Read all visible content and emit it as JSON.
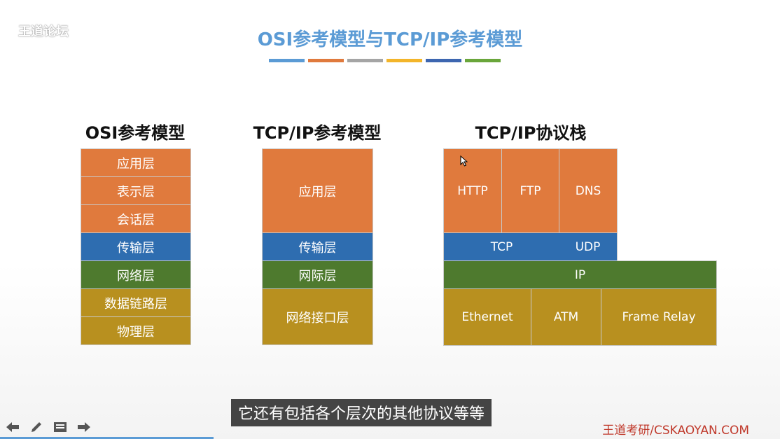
{
  "watermark": "王道论坛",
  "slide_title": "OSI参考模型与TCP/IP参考模型",
  "title_bar_colors": [
    "#5b9bd5",
    "#e07a3d",
    "#a5a5a5",
    "#f3b52a",
    "#3d66b0",
    "#6aa63b"
  ],
  "columns": {
    "osi": {
      "heading": "OSI参考模型",
      "layers": [
        "应用层",
        "表示层",
        "会话层",
        "传输层",
        "网络层",
        "数据链路层",
        "物理层"
      ]
    },
    "tcpip_model": {
      "heading": "TCP/IP参考模型",
      "layers": [
        "应用层",
        "传输层",
        "网际层",
        "网络接口层"
      ]
    },
    "tcpip_stack": {
      "heading": "TCP/IP协议栈",
      "application": [
        "HTTP",
        "FTP",
        "DNS"
      ],
      "transport": [
        "TCP",
        "UDP"
      ],
      "network": "IP",
      "link": [
        "Ethernet",
        "ATM",
        "Frame Relay"
      ]
    }
  },
  "colors": {
    "orange": "#e07a3d",
    "blue": "#2e6db0",
    "green": "#4e7a2e",
    "gold": "#b8901f",
    "title_blue": "#5b9bd5"
  },
  "subtitle": "它还有包括各个层次的其他协议等等",
  "brand": "王道考研/CSKAOYAN.COM",
  "toolbar": [
    {
      "icon": "arrow-left-icon",
      "glyph": "⬅"
    },
    {
      "icon": "pen-icon",
      "glyph": "✎"
    },
    {
      "icon": "notes-icon",
      "glyph": "▤"
    },
    {
      "icon": "arrow-right-icon",
      "glyph": "➡"
    }
  ]
}
